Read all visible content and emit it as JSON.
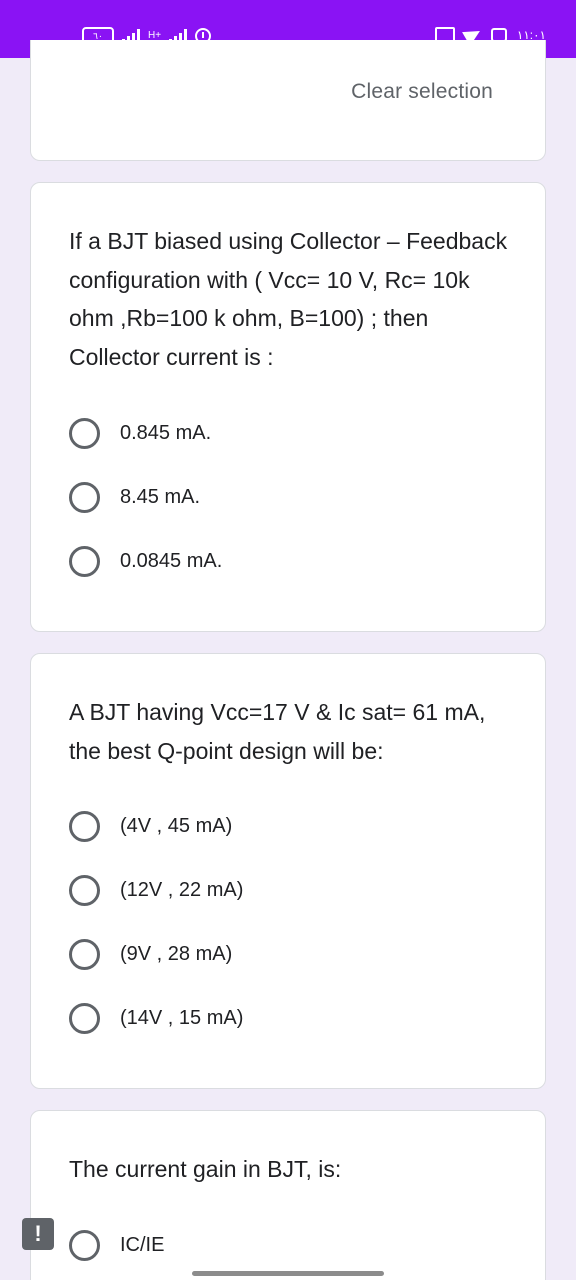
{
  "status_bar": {
    "battery": "٦٠",
    "network": "H+",
    "time": "١١:٠١"
  },
  "top_card": {
    "clear_label": "Clear selection"
  },
  "questions": [
    {
      "text": "If a BJT biased using Collector – Feedback configuration with ( Vcc= 10 V, Rc= 10k ohm ,Rb=100 k ohm, B=100) ; then Collector current is :",
      "options": [
        "0.845 mA.",
        "8.45 mA.",
        "0.0845 mA."
      ]
    },
    {
      "text": "A BJT having Vcc=17 V & Ic sat= 61 mA, the best Q-point design will be:",
      "options": [
        "(4V , 45 mA)",
        "(12V , 22 mA)",
        "(9V , 28 mA)",
        "(14V , 15 mA)"
      ]
    },
    {
      "text": "The current gain in BJT, is:",
      "options": [
        "IC/IE"
      ]
    }
  ],
  "feedback_icon_label": "!",
  "colors": {
    "status_bar": "#8a13f4",
    "page_bg": "#f0ebf8",
    "radio": "#5f6368"
  }
}
